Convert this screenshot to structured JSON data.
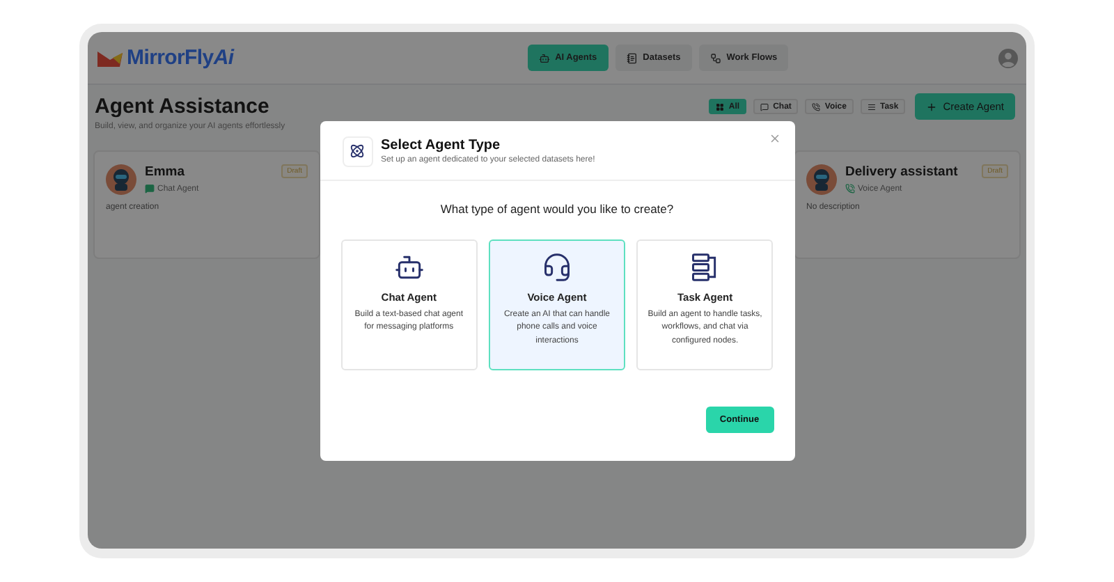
{
  "brand": {
    "name": "MirrorFly",
    "suffix": "Ai"
  },
  "nav_tabs": [
    {
      "label": "AI Agents",
      "kind": "agents",
      "selected": true
    },
    {
      "label": "Datasets",
      "kind": "datasets",
      "selected": false
    },
    {
      "label": "Work Flows",
      "kind": "workflows",
      "selected": false
    }
  ],
  "page": {
    "title": "Agent Assistance",
    "subtitle": "Build, view, and organize your AI agents effortlessly"
  },
  "filters": [
    {
      "label": "All",
      "kind": "all",
      "selected": true
    },
    {
      "label": "Chat",
      "kind": "chat",
      "selected": false
    },
    {
      "label": "Voice",
      "kind": "voice",
      "selected": false
    },
    {
      "label": "Task",
      "kind": "task",
      "selected": false
    }
  ],
  "create_button": "Create Agent",
  "agents": [
    {
      "name": "Emma",
      "type": "Chat Agent",
      "kind": "chat",
      "status": "Draft",
      "description": "agent creation"
    },
    {
      "name": "Delivery assistant",
      "type": "Voice Agent",
      "kind": "voice",
      "status": "Draft",
      "description": "No description"
    }
  ],
  "modal": {
    "title": "Select Agent Type",
    "subtitle": "Set up an agent dedicated to your selected datasets here!",
    "question": "What type of agent would you like to create?",
    "options": [
      {
        "kind": "chat",
        "title": "Chat Agent",
        "description": "Build a text-based chat agent for messaging platforms",
        "selected": false
      },
      {
        "kind": "voice",
        "title": "Voice Agent",
        "description": "Create an AI that can handle phone calls and voice interactions",
        "selected": true
      },
      {
        "kind": "task",
        "title": "Task Agent",
        "description": "Build an agent to handle tasks, workflows, and chat via configured nodes.",
        "selected": false
      }
    ],
    "button": "Continue"
  }
}
